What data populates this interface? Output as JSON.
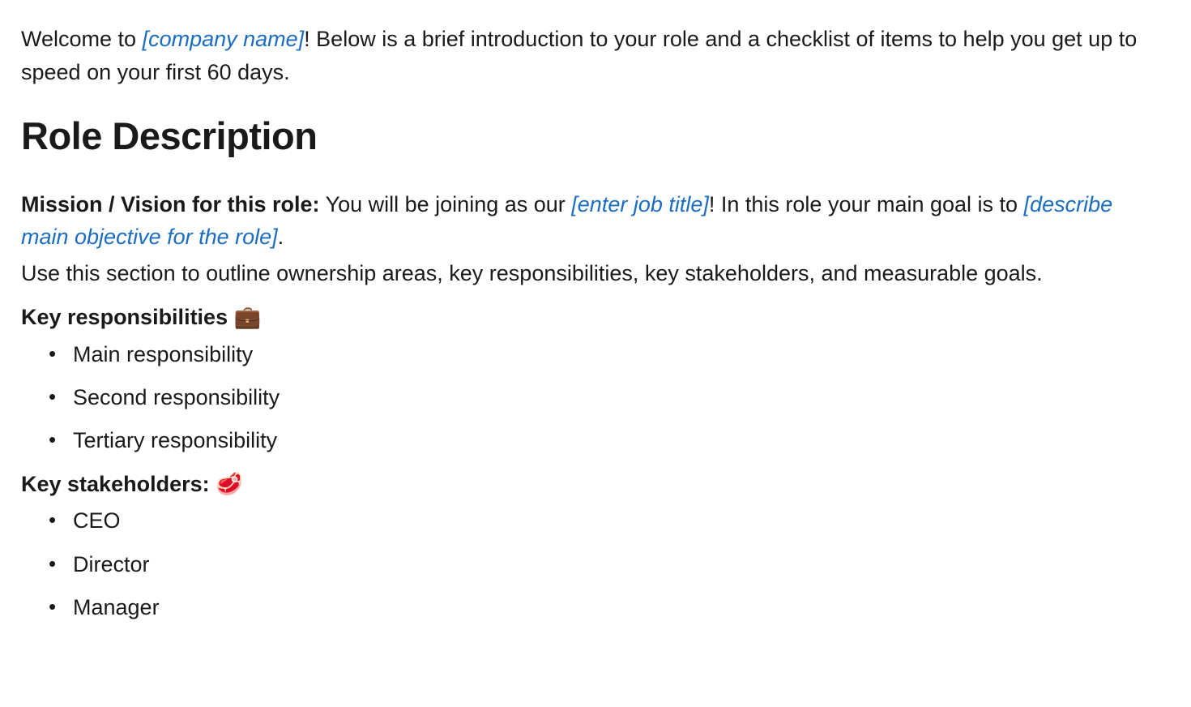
{
  "intro": {
    "prefix": "Welcome to ",
    "company_placeholder": "[company name]",
    "suffix": "! Below is a brief introduction to your role and a checklist of items to help you get up to speed on your first 60 days."
  },
  "role_description": {
    "heading": "Role Description",
    "mission": {
      "label": "Mission / Vision for this role:",
      "text_before_job": " You will be joining as our ",
      "job_title_placeholder": "[enter job title]",
      "text_after_job": "! In this role your main goal is to ",
      "objective_placeholder": "[describe main objective for the role]",
      "period": "."
    },
    "instruction": "Use this section to outline ownership areas, key responsibilities, key stakeholders, and measurable goals.",
    "responsibilities": {
      "heading_text": "Key responsibilities ",
      "heading_emoji": "💼",
      "items": [
        "Main responsibility",
        "Second responsibility",
        "Tertiary responsibility"
      ]
    },
    "stakeholders": {
      "heading_text": "Key stakeholders: ",
      "heading_emoji": "🥩",
      "items": [
        "CEO",
        "Director",
        "Manager"
      ]
    }
  }
}
